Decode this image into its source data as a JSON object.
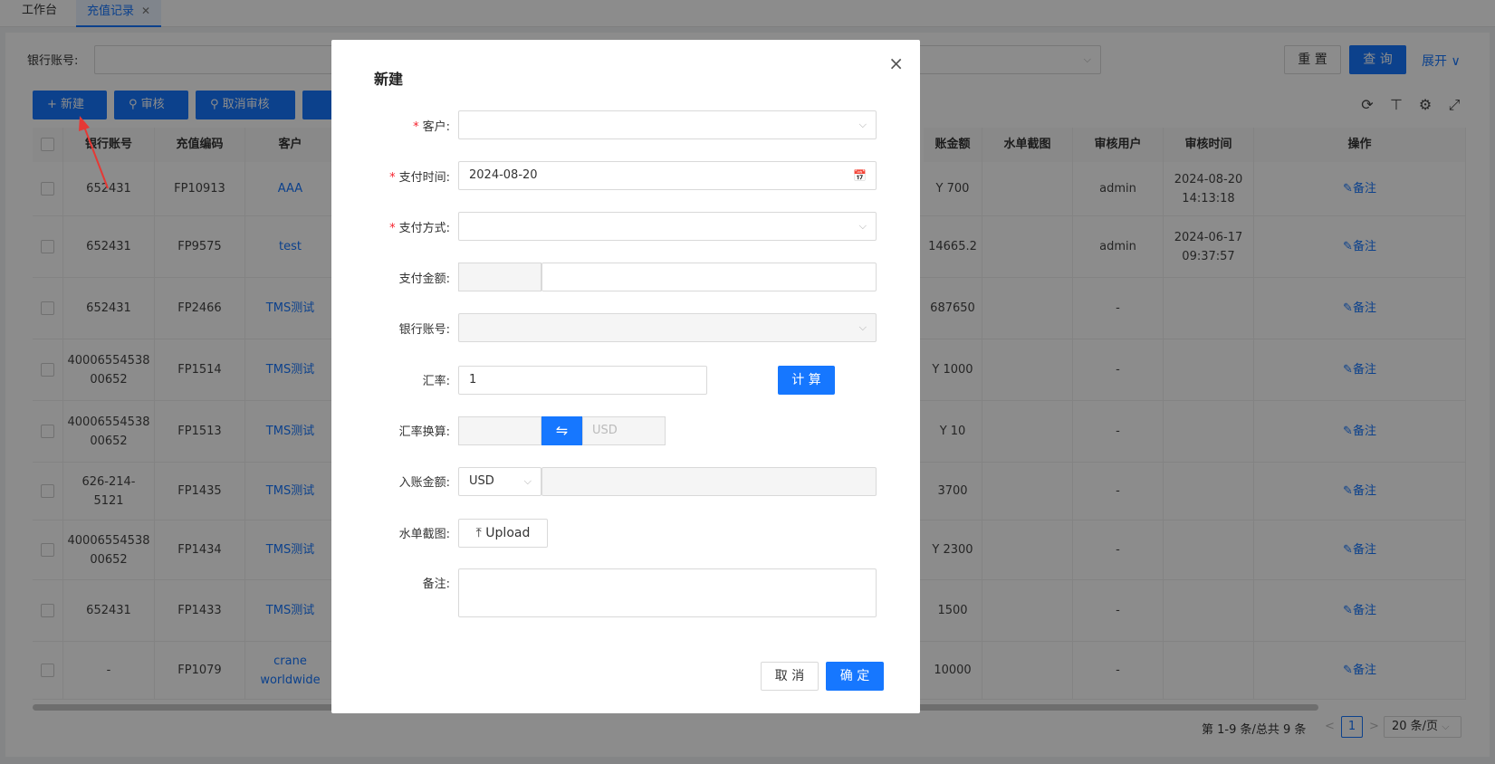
{
  "tabs": [
    {
      "label": "工作台"
    },
    {
      "label": "充值记录",
      "close": "✕"
    }
  ],
  "filter": {
    "bank_label": "银行账号:",
    "reset": "重 置",
    "search": "查 询",
    "expand": "展开 ∨"
  },
  "toolbar": {
    "new": "新建",
    "audit": "审核",
    "cancel_audit": "取消审核"
  },
  "table": {
    "headers": [
      "银行账号",
      "充值编码",
      "客户",
      "账金额",
      "水单截图",
      "审核用户",
      "审核时间",
      "操作"
    ],
    "rows": [
      {
        "bank": "652431",
        "code": "FP10913",
        "customer": "AAA",
        "amount": "Y 700",
        "auditor": "admin",
        "audit_time": "2024-08-20\n14:13:18",
        "op": "备注"
      },
      {
        "bank": "652431",
        "code": "FP9575",
        "customer": "test",
        "amount": "14665.2",
        "auditor": "admin",
        "audit_time": "2024-06-17\n09:37:57",
        "op": "备注"
      },
      {
        "bank": "652431",
        "code": "FP2466",
        "customer": "TMS测试",
        "amount": "687650",
        "auditor": "-",
        "audit_time": "",
        "op": "备注"
      },
      {
        "bank": "40006554538\n00652",
        "code": "FP1514",
        "customer": "TMS测试",
        "amount": "Y 1000",
        "auditor": "-",
        "audit_time": "",
        "op": "备注"
      },
      {
        "bank": "40006554538\n00652",
        "code": "FP1513",
        "customer": "TMS测试",
        "amount": "Y 10",
        "auditor": "-",
        "audit_time": "",
        "op": "备注"
      },
      {
        "bank": "626-214-\n5121",
        "code": "FP1435",
        "customer": "TMS测试",
        "amount": "3700",
        "auditor": "-",
        "audit_time": "",
        "op": "备注"
      },
      {
        "bank": "40006554538\n00652",
        "code": "FP1434",
        "customer": "TMS测试",
        "amount": "Y 2300",
        "auditor": "-",
        "audit_time": "",
        "op": "备注"
      },
      {
        "bank": "652431",
        "code": "FP1433",
        "customer": "TMS测试",
        "amount": "1500",
        "auditor": "-",
        "audit_time": "",
        "op": "备注"
      },
      {
        "bank": "-",
        "code": "FP1079",
        "customer": "crane\nworldwide",
        "amount": "10000",
        "auditor": "-",
        "audit_time": "",
        "op": "备注"
      }
    ]
  },
  "pager": {
    "summary": "第 1-9 条/总共 9 条",
    "prev": "<",
    "page": "1",
    "next": ">",
    "size": "20 条/页"
  },
  "modal": {
    "title": "新建",
    "close": "×",
    "fields": {
      "customer": "客户:",
      "pay_time": "支付时间:",
      "pay_time_value": "2024-08-20",
      "pay_method": "支付方式:",
      "pay_amount": "支付金额:",
      "bank": "银行账号:",
      "rate": "汇率:",
      "rate_value": "1",
      "calc": "计 算",
      "rate_convert": "汇率换算:",
      "convert_currency": "USD",
      "account_amount": "入账金额:",
      "account_currency": "USD",
      "screenshot": "水单截图:",
      "upload": "Upload",
      "remark": "备注:"
    },
    "required_mark": "*",
    "cancel": "取 消",
    "ok": "确 定"
  },
  "icons": {
    "chevron": "⌵",
    "calendar": "📅",
    "swap": "⇋",
    "upload": "⤒",
    "refresh": "⟳",
    "density": "⊤",
    "settings": "⚙",
    "fullscreen": "⤢",
    "search": "⚲",
    "edit": "✎",
    "plus": "+"
  },
  "colors": {
    "primary": "#1677ff",
    "required": "#f5222d",
    "arrow": "#e53935"
  }
}
